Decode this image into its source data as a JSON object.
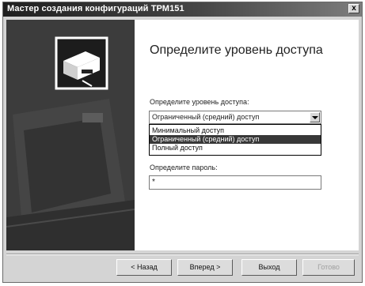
{
  "window": {
    "title": "Мастер создания конфигураций ТРМ151",
    "close_glyph": "x"
  },
  "page": {
    "heading": "Определите уровень доступа",
    "access_label": "Определите уровень доступа:",
    "access_selected": "Ограниченный (средний) доступ",
    "access_options": [
      "Минимальный доступ",
      "Ограниченный (средний) доступ",
      "Полный доступ"
    ],
    "password_label": "Определите пароль:",
    "password_value": "*"
  },
  "buttons": {
    "back": "< Назад",
    "next": "Вперед >",
    "exit": "Выход",
    "finish": "Готово"
  },
  "colors": {
    "titlebar": "#1f1f1f",
    "side_panel": "#3e3e3e",
    "selection": "#383838"
  },
  "icons": [
    "device-icon",
    "close-icon",
    "dropdown-arrow-icon"
  ]
}
